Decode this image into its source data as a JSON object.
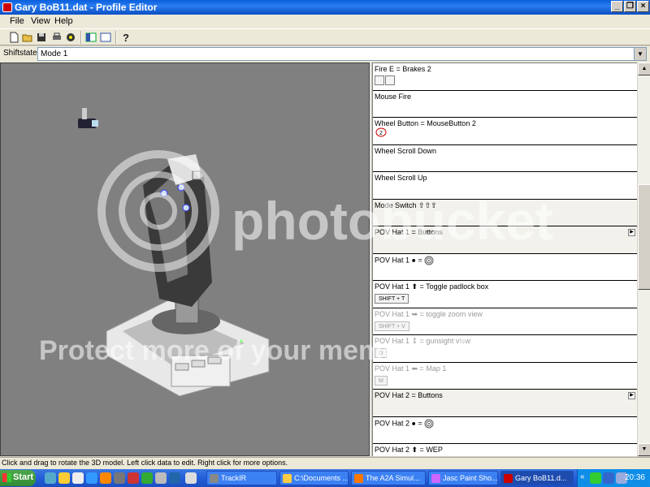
{
  "window": {
    "title": "Gary BoB11.dat - Profile Editor"
  },
  "menu": [
    {
      "label": "File"
    },
    {
      "label": "View"
    },
    {
      "label": "Help"
    }
  ],
  "toolbar": {
    "buttons": [
      "new-document-icon",
      "open-folder-icon",
      "save-icon",
      "print-icon",
      "test-profile-icon",
      "split-view-icon",
      "single-view-icon",
      "help-icon"
    ]
  },
  "shiftstate": {
    "label": "Shiftstate",
    "value": "Mode 1"
  },
  "bindings": [
    {
      "label": "Fire E = Brakes 2",
      "boxes": 2
    },
    {
      "label": "Mouse Fire"
    },
    {
      "label": "Wheel Button = MouseButton 2",
      "symbol": "2"
    },
    {
      "label": "Wheel Scroll Down"
    },
    {
      "label": "Wheel Scroll Up"
    },
    {
      "label": "Mode Switch",
      "arrows": "⇧⇧⇧"
    },
    {
      "label": "POV Hat 1 = Buttons"
    },
    {
      "label": "POV Hat 1  ●  ="
    },
    {
      "label": "POV Hat 1  ⬆  = Toggle padlock box",
      "key": "SHIFT + T"
    },
    {
      "label": "POV Hat 1  ➡  = toggle zoom view",
      "key": "SHIFT + V"
    },
    {
      "label": "POV Hat 1  ⬇  = gunsight view",
      "key": "D"
    },
    {
      "label": "POV Hat 1  ⬅  = Map 1",
      "key": "M"
    },
    {
      "label": "POV Hat 2 = Buttons"
    },
    {
      "label": "POV Hat 2  ●  ="
    },
    {
      "label": "POV Hat 2  ⬆  = WEP"
    }
  ],
  "status": {
    "text": "Click and drag to rotate the 3D model. Left click data to edit. Right click for more options."
  },
  "taskbar": {
    "start": "Start",
    "tasks": [
      {
        "label": "TrackIR"
      },
      {
        "label": "C:\\Documents ..."
      },
      {
        "label": "The A2A Simul..."
      },
      {
        "label": "Jasc Paint Sho..."
      },
      {
        "label": "Gary BoB11.d..."
      }
    ],
    "tray_chevron": "«",
    "clock": "20:36"
  },
  "watermark": {
    "line1": "photobucket",
    "line2": "Protect more of your memories for less!"
  }
}
